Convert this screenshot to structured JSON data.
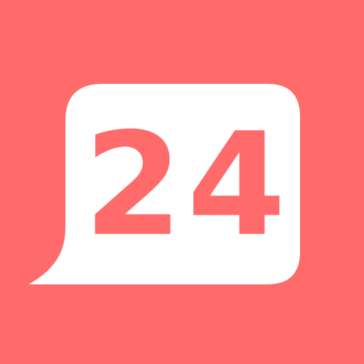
{
  "icon": {
    "number": "24",
    "background_color": "#ff6b6b",
    "bubble_color": "#ffffff",
    "text_color": "#ff6b6b",
    "glyph": "speech-bubble-icon"
  }
}
